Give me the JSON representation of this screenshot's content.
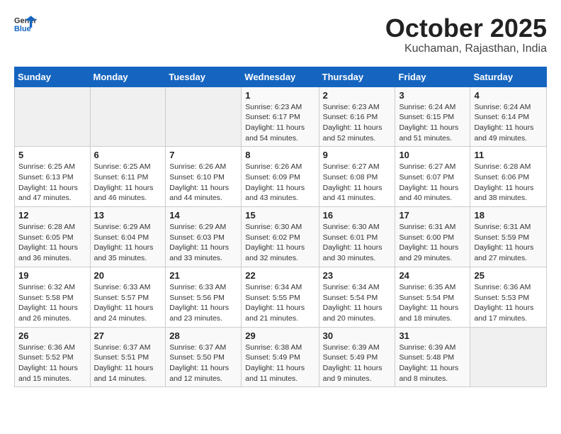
{
  "logo": {
    "line1": "General",
    "line2": "Blue"
  },
  "title": "October 2025",
  "subtitle": "Kuchaman, Rajasthan, India",
  "weekdays": [
    "Sunday",
    "Monday",
    "Tuesday",
    "Wednesday",
    "Thursday",
    "Friday",
    "Saturday"
  ],
  "weeks": [
    [
      {
        "day": "",
        "info": ""
      },
      {
        "day": "",
        "info": ""
      },
      {
        "day": "",
        "info": ""
      },
      {
        "day": "1",
        "info": "Sunrise: 6:23 AM\nSunset: 6:17 PM\nDaylight: 11 hours\nand 54 minutes."
      },
      {
        "day": "2",
        "info": "Sunrise: 6:23 AM\nSunset: 6:16 PM\nDaylight: 11 hours\nand 52 minutes."
      },
      {
        "day": "3",
        "info": "Sunrise: 6:24 AM\nSunset: 6:15 PM\nDaylight: 11 hours\nand 51 minutes."
      },
      {
        "day": "4",
        "info": "Sunrise: 6:24 AM\nSunset: 6:14 PM\nDaylight: 11 hours\nand 49 minutes."
      }
    ],
    [
      {
        "day": "5",
        "info": "Sunrise: 6:25 AM\nSunset: 6:13 PM\nDaylight: 11 hours\nand 47 minutes."
      },
      {
        "day": "6",
        "info": "Sunrise: 6:25 AM\nSunset: 6:11 PM\nDaylight: 11 hours\nand 46 minutes."
      },
      {
        "day": "7",
        "info": "Sunrise: 6:26 AM\nSunset: 6:10 PM\nDaylight: 11 hours\nand 44 minutes."
      },
      {
        "day": "8",
        "info": "Sunrise: 6:26 AM\nSunset: 6:09 PM\nDaylight: 11 hours\nand 43 minutes."
      },
      {
        "day": "9",
        "info": "Sunrise: 6:27 AM\nSunset: 6:08 PM\nDaylight: 11 hours\nand 41 minutes."
      },
      {
        "day": "10",
        "info": "Sunrise: 6:27 AM\nSunset: 6:07 PM\nDaylight: 11 hours\nand 40 minutes."
      },
      {
        "day": "11",
        "info": "Sunrise: 6:28 AM\nSunset: 6:06 PM\nDaylight: 11 hours\nand 38 minutes."
      }
    ],
    [
      {
        "day": "12",
        "info": "Sunrise: 6:28 AM\nSunset: 6:05 PM\nDaylight: 11 hours\nand 36 minutes."
      },
      {
        "day": "13",
        "info": "Sunrise: 6:29 AM\nSunset: 6:04 PM\nDaylight: 11 hours\nand 35 minutes."
      },
      {
        "day": "14",
        "info": "Sunrise: 6:29 AM\nSunset: 6:03 PM\nDaylight: 11 hours\nand 33 minutes."
      },
      {
        "day": "15",
        "info": "Sunrise: 6:30 AM\nSunset: 6:02 PM\nDaylight: 11 hours\nand 32 minutes."
      },
      {
        "day": "16",
        "info": "Sunrise: 6:30 AM\nSunset: 6:01 PM\nDaylight: 11 hours\nand 30 minutes."
      },
      {
        "day": "17",
        "info": "Sunrise: 6:31 AM\nSunset: 6:00 PM\nDaylight: 11 hours\nand 29 minutes."
      },
      {
        "day": "18",
        "info": "Sunrise: 6:31 AM\nSunset: 5:59 PM\nDaylight: 11 hours\nand 27 minutes."
      }
    ],
    [
      {
        "day": "19",
        "info": "Sunrise: 6:32 AM\nSunset: 5:58 PM\nDaylight: 11 hours\nand 26 minutes."
      },
      {
        "day": "20",
        "info": "Sunrise: 6:33 AM\nSunset: 5:57 PM\nDaylight: 11 hours\nand 24 minutes."
      },
      {
        "day": "21",
        "info": "Sunrise: 6:33 AM\nSunset: 5:56 PM\nDaylight: 11 hours\nand 23 minutes."
      },
      {
        "day": "22",
        "info": "Sunrise: 6:34 AM\nSunset: 5:55 PM\nDaylight: 11 hours\nand 21 minutes."
      },
      {
        "day": "23",
        "info": "Sunrise: 6:34 AM\nSunset: 5:54 PM\nDaylight: 11 hours\nand 20 minutes."
      },
      {
        "day": "24",
        "info": "Sunrise: 6:35 AM\nSunset: 5:54 PM\nDaylight: 11 hours\nand 18 minutes."
      },
      {
        "day": "25",
        "info": "Sunrise: 6:36 AM\nSunset: 5:53 PM\nDaylight: 11 hours\nand 17 minutes."
      }
    ],
    [
      {
        "day": "26",
        "info": "Sunrise: 6:36 AM\nSunset: 5:52 PM\nDaylight: 11 hours\nand 15 minutes."
      },
      {
        "day": "27",
        "info": "Sunrise: 6:37 AM\nSunset: 5:51 PM\nDaylight: 11 hours\nand 14 minutes."
      },
      {
        "day": "28",
        "info": "Sunrise: 6:37 AM\nSunset: 5:50 PM\nDaylight: 11 hours\nand 12 minutes."
      },
      {
        "day": "29",
        "info": "Sunrise: 6:38 AM\nSunset: 5:49 PM\nDaylight: 11 hours\nand 11 minutes."
      },
      {
        "day": "30",
        "info": "Sunrise: 6:39 AM\nSunset: 5:49 PM\nDaylight: 11 hours\nand 9 minutes."
      },
      {
        "day": "31",
        "info": "Sunrise: 6:39 AM\nSunset: 5:48 PM\nDaylight: 11 hours\nand 8 minutes."
      },
      {
        "day": "",
        "info": ""
      }
    ]
  ]
}
